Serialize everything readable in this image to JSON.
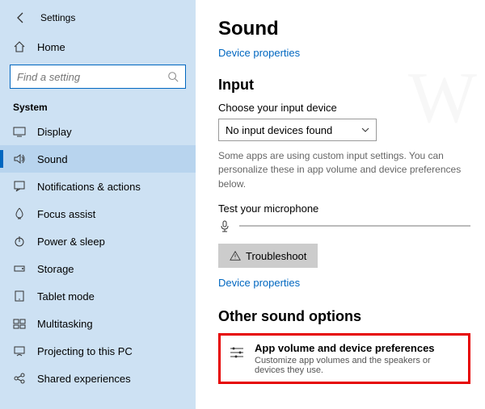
{
  "app_title": "Settings",
  "home_label": "Home",
  "search_placeholder": "Find a setting",
  "section_label": "System",
  "nav": [
    {
      "label": "Display"
    },
    {
      "label": "Sound"
    },
    {
      "label": "Notifications & actions"
    },
    {
      "label": "Focus assist"
    },
    {
      "label": "Power & sleep"
    },
    {
      "label": "Storage"
    },
    {
      "label": "Tablet mode"
    },
    {
      "label": "Multitasking"
    },
    {
      "label": "Projecting to this PC"
    },
    {
      "label": "Shared experiences"
    }
  ],
  "page_title": "Sound",
  "device_properties": "Device properties",
  "input_heading": "Input",
  "choose_input_label": "Choose your input device",
  "input_selected": "No input devices found",
  "input_help": "Some apps are using custom input settings. You can personalize these in app volume and device preferences below.",
  "test_mic_label": "Test your microphone",
  "troubleshoot_label": "Troubleshoot",
  "device_properties2": "Device properties",
  "other_heading": "Other sound options",
  "card_title": "App volume and device preferences",
  "card_sub": "Customize app volumes and the speakers or devices they use."
}
